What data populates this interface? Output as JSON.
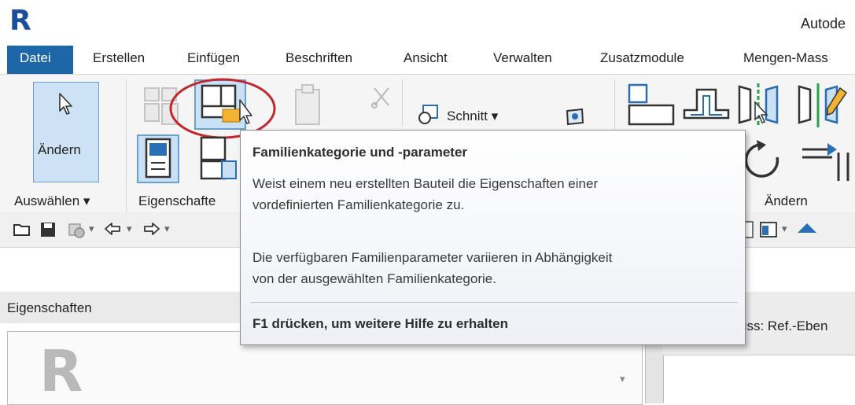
{
  "app": {
    "logo_letter": "R",
    "window_title": "Autode"
  },
  "menu": {
    "tabs": [
      {
        "label": "Datei"
      },
      {
        "label": "Erstellen"
      },
      {
        "label": "Einfügen"
      },
      {
        "label": "Beschriften"
      },
      {
        "label": "Ansicht"
      },
      {
        "label": "Verwalten"
      },
      {
        "label": "Zusatzmodule"
      },
      {
        "label": "Mengen-Mass"
      }
    ]
  },
  "ribbon": {
    "modify_label": "Ändern",
    "select_panel_label": "Auswählen ▾",
    "properties_panel_label": "Eigenschafte",
    "section_label": "Schnitt ▾",
    "modify_panel_label": "Ändern"
  },
  "tooltip": {
    "title": "Familienkategorie und -parameter",
    "description_line1": "Weist einem neu erstellten Bauteil die Eigenschaften einer",
    "description_line2": "vordefinierten Familienkategorie zu.",
    "detail_line1": "Die verfügbaren Familienparameter variieren in Abhängigkeit",
    "detail_line2": "von der ausgewählten Familienkategorie.",
    "help_text": "F1 drücken, um weitere Hilfe zu erhalten"
  },
  "properties_panel": {
    "title": "Eigenschaften",
    "logo_letter": "R"
  },
  "view_tab": {
    "label": "riss: Ref.-Eben"
  },
  "colors": {
    "accent": "#1d66a8",
    "highlight_circle": "#c0282d",
    "folder": "#f2b233"
  }
}
